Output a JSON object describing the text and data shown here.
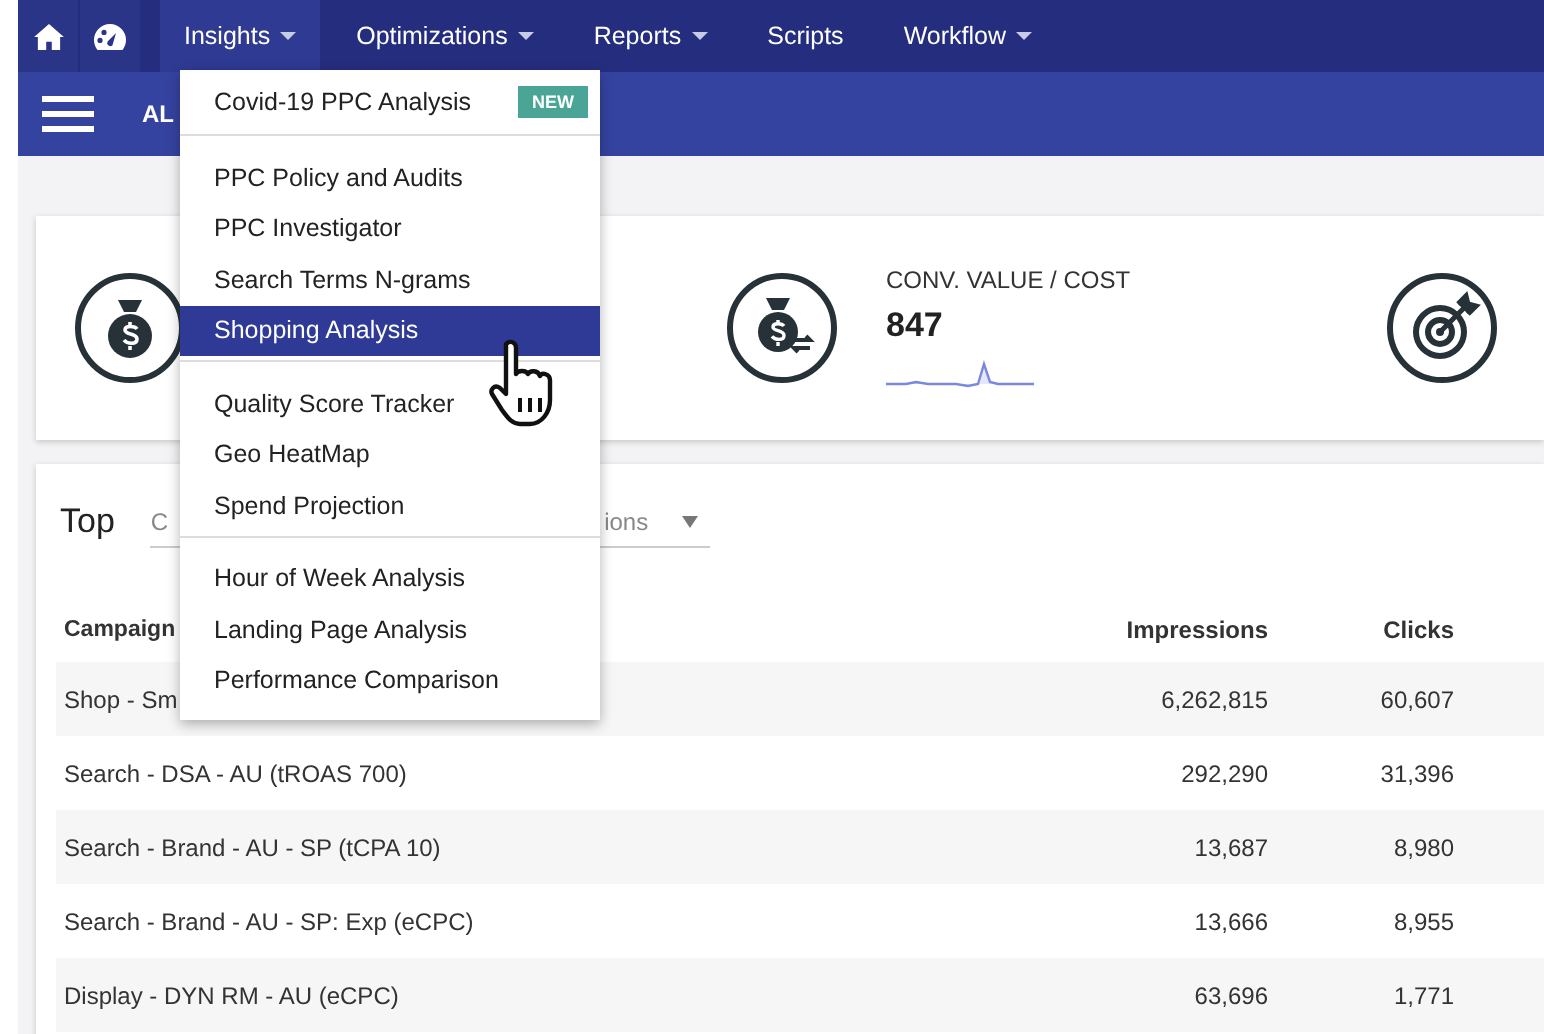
{
  "nav": {
    "items": [
      {
        "label": "Insights",
        "has_menu": true,
        "selected": true
      },
      {
        "label": "Optimizations",
        "has_menu": true,
        "selected": false
      },
      {
        "label": "Reports",
        "has_menu": true,
        "selected": false
      },
      {
        "label": "Scripts",
        "has_menu": false,
        "selected": false
      },
      {
        "label": "Workflow",
        "has_menu": true,
        "selected": false
      }
    ]
  },
  "subbar": {
    "title": "AL"
  },
  "metrics": [
    {
      "kind": "money"
    },
    {
      "kind": "money-exchange",
      "label": "CONV. VALUE / COST",
      "value": "847",
      "sparkline": true
    },
    {
      "kind": "target"
    }
  ],
  "top_panel": {
    "title": "Top",
    "filter_prefix": "C",
    "filter_value": "ions"
  },
  "table": {
    "columns": [
      "Campaign",
      "Impressions",
      "Clicks"
    ],
    "rows": [
      [
        "Shop - Sm",
        "6,262,815",
        "60,607"
      ],
      [
        "Search - DSA - AU (tROAS 700)",
        "292,290",
        "31,396"
      ],
      [
        "Search - Brand - AU - SP (tCPA 10)",
        "13,687",
        "8,980"
      ],
      [
        "Search - Brand - AU - SP: Exp (eCPC)",
        "13,666",
        "8,955"
      ],
      [
        "Display - DYN RM - AU (eCPC)",
        "63,696",
        "1,771"
      ]
    ]
  },
  "insights_menu": {
    "groups": [
      {
        "items": [
          {
            "label": "Covid-19 PPC Analysis",
            "selected": false,
            "badge": "NEW"
          }
        ]
      },
      {
        "items": [
          {
            "label": "PPC Policy and Audits",
            "selected": false
          },
          {
            "label": "PPC Investigator",
            "selected": false
          },
          {
            "label": "Search Terms N-grams",
            "selected": false
          },
          {
            "label": "Shopping Analysis",
            "selected": true
          }
        ]
      },
      {
        "items": [
          {
            "label": "Quality Score Tracker",
            "selected": false
          },
          {
            "label": "Geo HeatMap",
            "selected": false
          },
          {
            "label": "Spend Projection",
            "selected": false
          }
        ]
      },
      {
        "items": [
          {
            "label": "Hour of Week Analysis",
            "selected": false
          },
          {
            "label": "Landing Page Analysis",
            "selected": false
          },
          {
            "label": "Performance Comparison",
            "selected": false
          }
        ]
      }
    ]
  }
}
